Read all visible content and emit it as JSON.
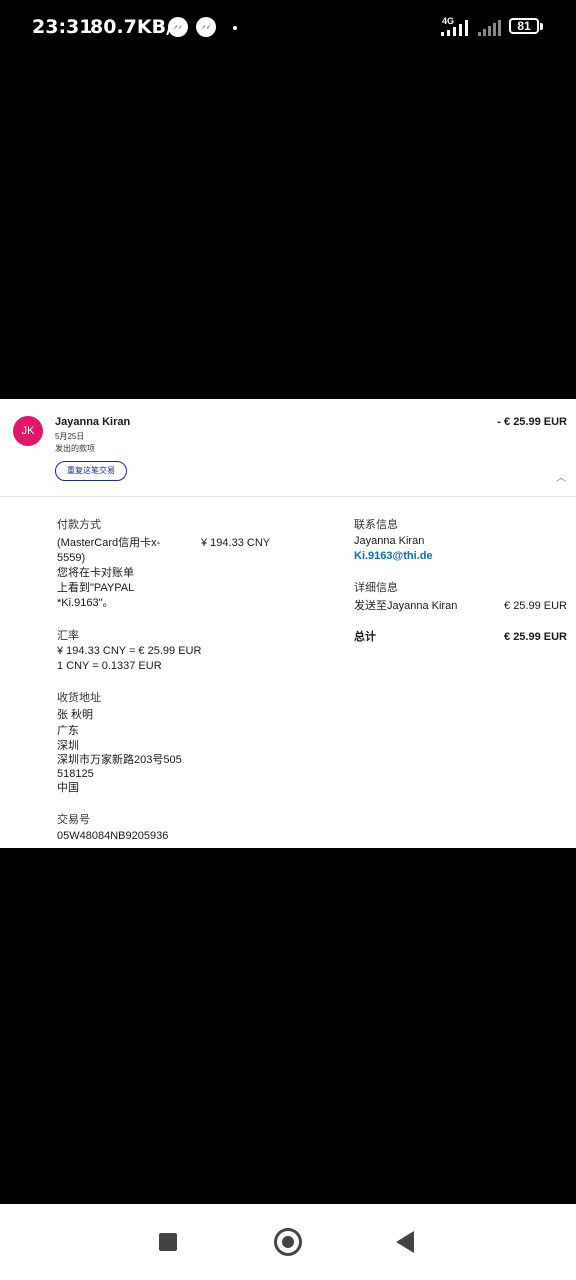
{
  "status_bar": {
    "time": "23:31",
    "speed": "80.7KB/s",
    "network": "4G",
    "battery": "81"
  },
  "transaction": {
    "avatar_initials": "JK",
    "name": "Jayanna Kiran",
    "date": "5月25日",
    "type": "发出的款项",
    "amount": "- € 25.99 EUR",
    "repeat_button": "重复这笔交易"
  },
  "payment_method": {
    "heading": "付款方式",
    "card_line1": "(MasterCard信用卡x-",
    "card_line2": "5559)",
    "amount_cny": "¥ 194.33 CNY",
    "statement_line1": "您将在卡对账单",
    "statement_line2": "上看到\"PAYPAL",
    "statement_line3": "*Ki.9163\"。"
  },
  "exchange_rate": {
    "heading": "汇率",
    "line1": "¥ 194.33 CNY = € 25.99 EUR",
    "line2": "1 CNY = 0.1337 EUR"
  },
  "shipping_address": {
    "heading": "收货地址",
    "lines": [
      "张 秋明",
      "广东",
      "深圳",
      "深圳市万家新路203号505",
      "518125",
      "中国"
    ]
  },
  "transaction_id": {
    "heading": "交易号",
    "value": "05W48084NB9205936"
  },
  "contact": {
    "heading": "联系信息",
    "name": "Jayanna Kiran",
    "email": "Ki.9163@thi.de"
  },
  "details": {
    "heading": "详细信息",
    "sent_to_label": "发送至Jayanna Kiran",
    "sent_to_amount": "€ 25.99 EUR",
    "total_label": "总计",
    "total_amount": "€ 25.99 EUR"
  },
  "colors": {
    "avatar_bg": "#e3166b",
    "link": "#0a6fb8",
    "button_border": "#142c8e"
  }
}
